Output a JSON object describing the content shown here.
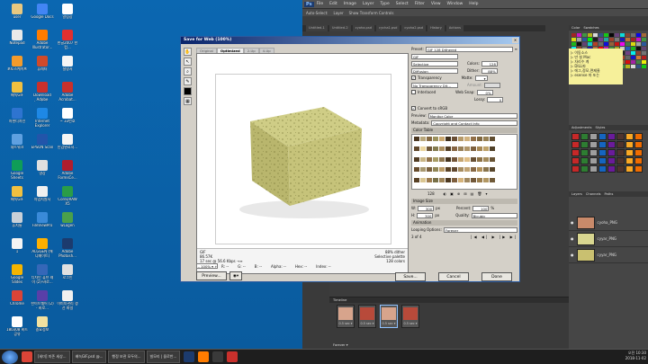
{
  "desktop_icons": [
    {
      "label": "user",
      "color": "#e8c880"
    },
    {
      "label": "Notepad",
      "color": "#e9e9e9"
    },
    {
      "label": "포토스케이프",
      "color": "#f39b2c"
    },
    {
      "label": "배녹GIF",
      "color": "#f0c040"
    },
    {
      "label": "저현디자인",
      "color": "#2e74d0"
    },
    {
      "label": "네트워크",
      "color": "#5fa0e0"
    },
    {
      "label": "Google Sheets",
      "color": "#0f9d58"
    },
    {
      "label": "배녹GIF",
      "color": "#f0c040"
    },
    {
      "label": "휴지통",
      "color": "#c8d0d8"
    },
    {
      "label": "1",
      "color": "#f4f4f4"
    },
    {
      "label": "Google Slides",
      "color": "#f4b400"
    },
    {
      "label": "Chrome",
      "color": "#db4437"
    },
    {
      "label": "180308 비트공유",
      "color": "#ffffff"
    },
    {
      "label": "Google Docs",
      "color": "#4285f4"
    },
    {
      "label": "Adobe Illustrator...",
      "color": "#ff7c00"
    },
    {
      "label": "휴레터",
      "color": "#d04a2a"
    },
    {
      "label": "Download Adobe Acrobat...",
      "color": "#c9302c"
    },
    {
      "label": "Internet Explorer",
      "color": "#1e88e5"
    },
    {
      "label": "EPSON Scan",
      "color": "#2255aa"
    },
    {
      "label": "영상",
      "color": "#e0e0e0"
    },
    {
      "label": "자업지원서",
      "color": "#f0f0f0"
    },
    {
      "label": "FileViewPro",
      "color": "#3a8ad8"
    },
    {
      "label": "ALGGEN (애니메이트)",
      "color": "#ffb000"
    },
    {
      "label": "디자인 퓨브 레이 (2)-바로...",
      "color": "#3567b8"
    },
    {
      "label": "한이드웨어 (2) - 바로...",
      "color": "#5a3fa8"
    },
    {
      "label": "중요정보",
      "color": "#f2e1a0"
    },
    {
      "label": "알림장",
      "color": "#ffffff"
    },
    {
      "label": "한글2007 한컴...",
      "color": "#e03030"
    },
    {
      "label": "설명서",
      "color": "#f5f5f5"
    },
    {
      "label": "Adobe Acrobat...",
      "color": "#c9302c"
    },
    {
      "label": "~ 33번호",
      "color": "#ffffff"
    },
    {
      "label": "안감완료서...",
      "color": "#f5f5f5"
    },
    {
      "label": "Adobe FormsCe...",
      "color": "#b01e2e"
    },
    {
      "label": "CoreDRAW X5",
      "color": "#2a9d48"
    },
    {
      "label": "wLogen",
      "color": "#4aa04a"
    },
    {
      "label": "Adobe Photosh...",
      "color": "#1c3b6e"
    },
    {
      "label": "로그인",
      "color": "#e0e0e0"
    },
    {
      "label": "이미지관리 생선 파일",
      "color": "#f0f0f0"
    }
  ],
  "photoshop": {
    "logo": "Ps",
    "menu": [
      "File",
      "Edit",
      "Image",
      "Layer",
      "Type",
      "Select",
      "Filter",
      "View",
      "Window",
      "Help"
    ],
    "options_bar": [
      "Auto-Select:",
      "Layer",
      "Show Transform Controls"
    ],
    "doc_tabs": [
      "Untitled-1",
      "Untitled-2",
      "cyoha.psd",
      "cycha1.psd",
      "cyoha2.psd",
      "History",
      "Actions"
    ],
    "panel_tabs": [
      "Color",
      "Swatches"
    ],
    "adjust_tabs": [
      "Adjustments",
      "Styles"
    ],
    "layers_tabs": [
      "Layers",
      "Channels",
      "Paths"
    ],
    "layers": [
      {
        "name": "cyoha_PNG",
        "color": "#c98a6a"
      },
      {
        "name": "cyyar_PNG",
        "color": "#d8d690"
      },
      {
        "name": "cyyar_PNG",
        "color": "#c9c070"
      }
    ],
    "sticky_lines": [
      "▷ 이동소스",
      "▷ 만 설 Mac",
      "▷ 자리수 계",
      "▷ DILL파",
      "▷ 에그,정모,면제울",
      "▷ esense 마 또는"
    ],
    "timeline_label": "Timeline",
    "frames": [
      {
        "label": "1",
        "delay": "0.5 sec ▾"
      },
      {
        "label": "2",
        "delay": "0.5 sec ▾"
      },
      {
        "label": "3",
        "delay": "0.5 sec ▾"
      },
      {
        "label": "4",
        "delay": "0.5 sec ▾"
      }
    ],
    "timeline_footer": "Forever ▾"
  },
  "dialog": {
    "title": "Save for Web (100%)",
    "view_tabs": [
      "Original",
      "Optimized",
      "2-Up",
      "4-Up"
    ],
    "info_left": [
      "GIF",
      "86.57K",
      "17 sec @ 56.6 Kbps  →≡"
    ],
    "info_right": [
      "88% dither",
      "Selective palette",
      "128 colors"
    ],
    "zoom": "100%",
    "readouts": [
      "R: --",
      "G: --",
      "B: --",
      "Alpha: --",
      "Hex: --",
      "Index: --"
    ],
    "preview_btn": "Preview...",
    "preset_label": "Preset:",
    "preset_value": "GIF 128 Dithered",
    "format": "GIF",
    "reduction": "Selective",
    "colors_label": "Colors:",
    "colors_value": "128",
    "dither_algo": "Diffusion",
    "dither_label": "Dither:",
    "dither_value": "88%",
    "transparency_label": "Transparency",
    "matte_label": "Matte:",
    "trans_dither": "No Transparency Dit...",
    "amount_label": "Amount:",
    "interlaced_label": "Interlaced",
    "websnap_label": "Web Snap:",
    "websnap_value": "0%",
    "lossy_label": "Lossy:",
    "lossy_value": "0",
    "convert_label": "Convert to sRGB",
    "preview_label": "Preview:",
    "preview_value": "Monitor Color",
    "metadata_label": "Metadata:",
    "metadata_value": "Copyright and Contact Info",
    "color_table_label": "Color Table",
    "color_count": "128",
    "image_size_label": "Image Size",
    "w_label": "W:",
    "w_value": "300",
    "h_label": "H:",
    "h_value": "300",
    "px": "px",
    "percent_label": "Percent:",
    "percent_value": "100",
    "pct": "%",
    "quality_label": "Quality:",
    "quality_value": "Bicubic",
    "animation_label": "Animation",
    "looping_label": "Looping Options:",
    "looping_value": "Forever",
    "frame_counter": "3 of 4",
    "save_btn": "Save...",
    "cancel_btn": "Cancel",
    "done_btn": "Done"
  },
  "taskbar": {
    "items": [
      "[세미] 미존 세상...",
      "배녹GIF.psd @...",
      "행정 보관 모두의...",
      "빌모리 | 믈로반..."
    ],
    "tray": {
      "time": "오전 10:30",
      "date": "2018-11-02"
    }
  }
}
